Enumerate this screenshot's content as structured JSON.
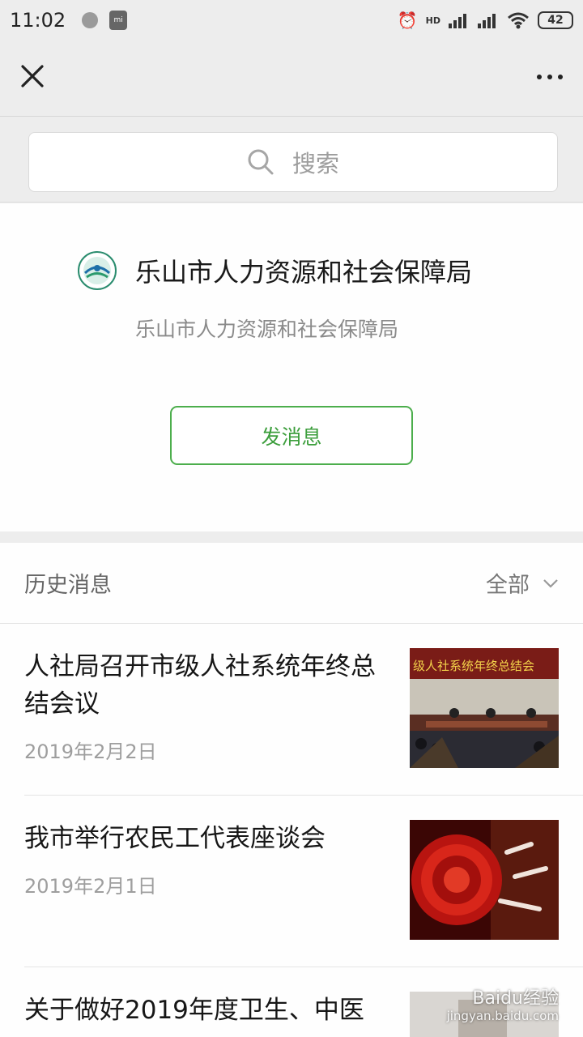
{
  "status_bar": {
    "time": "11:02",
    "network_badge": "HD",
    "battery": "42"
  },
  "nav": {
    "close_icon": "close-icon",
    "more_icon": "more-icon"
  },
  "search": {
    "placeholder": "搜索"
  },
  "profile": {
    "name": "乐山市人力资源和社会保障局",
    "description": "乐山市人力资源和社会保障局",
    "message_button": "发消息"
  },
  "history": {
    "title": "历史消息",
    "filter_label": "全部",
    "articles": [
      {
        "title": "人社局召开市级人社系统年终总结会议",
        "date": "2019年2月2日",
        "banner": "级人社系统年终总结会"
      },
      {
        "title": "我市举行农民工代表座谈会",
        "date": "2019年2月1日"
      },
      {
        "title": "关于做好2019年度卫生、中医"
      }
    ]
  },
  "watermark": {
    "brand": "Baidu经验",
    "url": "jingyan.baidu.com"
  },
  "colors": {
    "accent_green": "#4cae4c",
    "background": "#ededed"
  }
}
